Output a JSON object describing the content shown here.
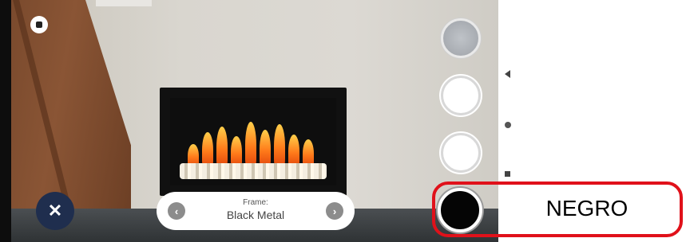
{
  "scene": {
    "home_icon": "home-icon",
    "close_icon_glyph": "✕"
  },
  "frame_selector": {
    "label": "Frame:",
    "value": "Black Metal",
    "prev_glyph": "‹",
    "next_glyph": "›"
  },
  "swatches": [
    {
      "name": "silver",
      "color": "#a9adb2"
    },
    {
      "name": "white",
      "color": "#ffffff"
    },
    {
      "name": "white",
      "color": "#ffffff"
    },
    {
      "name": "black",
      "color": "#050505",
      "selected": true
    }
  ],
  "annotation": {
    "text": "NEGRO",
    "highlight_color": "#e0111a"
  }
}
